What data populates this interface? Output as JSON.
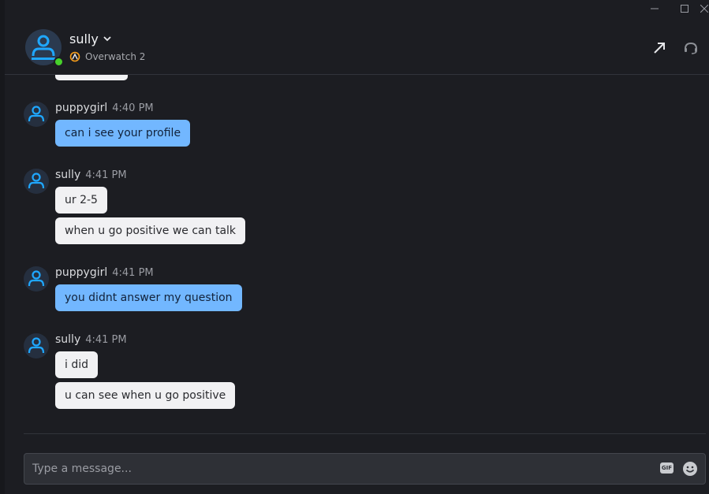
{
  "window": {
    "minimize": "—",
    "maximize": "☐",
    "close": "✕"
  },
  "header": {
    "contact_name": "sully",
    "game": "Overwatch 2",
    "colors": {
      "presence": "#47d12b",
      "accent": "#1fa7ff"
    }
  },
  "messages": [
    {
      "author": "puppygirl",
      "time": "4:40 PM",
      "variant": "self",
      "bubbles": [
        "can i see your profile"
      ]
    },
    {
      "author": "sully",
      "time": "4:41 PM",
      "variant": "other",
      "bubbles": [
        "ur 2-5",
        "when u go positive we can talk"
      ]
    },
    {
      "author": "puppygirl",
      "time": "4:41 PM",
      "variant": "self",
      "bubbles": [
        "you didnt answer my question"
      ]
    },
    {
      "author": "sully",
      "time": "4:41 PM",
      "variant": "other",
      "bubbles": [
        "i did",
        "u can see when u go positive"
      ]
    }
  ],
  "composer": {
    "placeholder": "Type a message...",
    "gif_label": "GIF"
  }
}
